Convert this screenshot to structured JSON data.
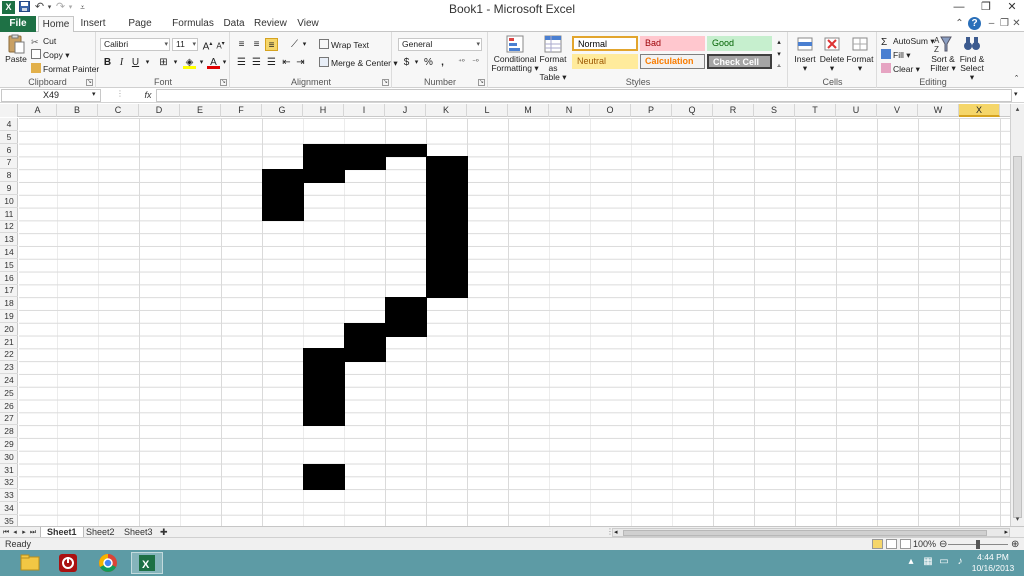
{
  "window": {
    "title": "Book1 - Microsoft Excel",
    "app_icon": "X"
  },
  "ribbon_tabs": [
    "File",
    "Home",
    "Insert",
    "Page Layout",
    "Formulas",
    "Data",
    "Review",
    "View"
  ],
  "active_tab": "Home",
  "clipboard": {
    "paste": "Paste",
    "cut": "Cut",
    "copy": "Copy",
    "format_painter": "Format Painter",
    "group": "Clipboard"
  },
  "font": {
    "name": "Calibri",
    "size": "11",
    "bold": "B",
    "italic": "I",
    "underline": "U",
    "group": "Font"
  },
  "alignment": {
    "wrap_text": "Wrap Text",
    "merge_center": "Merge & Center",
    "group": "Alignment"
  },
  "number": {
    "format": "General",
    "currency": "$",
    "percent": "%",
    "comma": ",",
    "group": "Number"
  },
  "styles": {
    "conditional": "Conditional Formatting",
    "conditional_l1": "Conditional",
    "conditional_l2": "Formatting",
    "table_l1": "Format",
    "table_l2": "as Table",
    "cells": [
      {
        "label": "Normal",
        "bg": "#ffffff",
        "fg": "#000000",
        "border": "#e2a52d"
      },
      {
        "label": "Bad",
        "bg": "#ffc7ce",
        "fg": "#9c0006",
        "border": "#ffc7ce"
      },
      {
        "label": "Good",
        "bg": "#c6efce",
        "fg": "#006100",
        "border": "#c6efce"
      },
      {
        "label": "Neutral",
        "bg": "#ffeb9c",
        "fg": "#9c5700",
        "border": "#ffeb9c"
      },
      {
        "label": "Calculation",
        "bg": "#f2f2f2",
        "fg": "#fa7d00",
        "border": "#7f7f7f"
      },
      {
        "label": "Check Cell",
        "bg": "#a5a5a5",
        "fg": "#ffffff",
        "border": "#3f3f3f"
      }
    ],
    "group": "Styles"
  },
  "cells_group": {
    "insert": "Insert",
    "delete": "Delete",
    "format": "Format",
    "group": "Cells"
  },
  "editing": {
    "autosum": "AutoSum",
    "fill": "Fill",
    "clear": "Clear",
    "sort_l1": "Sort &",
    "sort_l2": "Filter",
    "find_l1": "Find &",
    "find_l2": "Select",
    "group": "Editing"
  },
  "formula_bar": {
    "name_box": "X49",
    "fx": "fx",
    "value": ""
  },
  "grid": {
    "columns": [
      "A",
      "B",
      "C",
      "D",
      "E",
      "F",
      "G",
      "H",
      "I",
      "J",
      "K",
      "L",
      "M",
      "N",
      "O",
      "P",
      "Q",
      "R",
      "S",
      "T",
      "U",
      "V",
      "W",
      "X"
    ],
    "selected_column": "X",
    "first_row": 4,
    "rows": [
      "4",
      "5",
      "6",
      "7",
      "8",
      "9",
      "10",
      "11",
      "12",
      "13",
      "14",
      "15",
      "16",
      "17",
      "18",
      "19",
      "20",
      "21",
      "22",
      "23",
      "24",
      "25",
      "26",
      "27",
      "28",
      "29",
      "30",
      "31",
      "32",
      "33",
      "34",
      "35"
    ],
    "filled_cells": [
      {
        "col": "H",
        "row": 6
      },
      {
        "col": "I",
        "row": 6
      },
      {
        "col": "J",
        "row": 6
      },
      {
        "col": "H",
        "row": 7
      },
      {
        "col": "I",
        "row": 7
      },
      {
        "col": "K",
        "row": 7
      },
      {
        "col": "G",
        "row": 8
      },
      {
        "col": "H",
        "row": 8
      },
      {
        "col": "K",
        "row": 8
      },
      {
        "col": "G",
        "row": 9
      },
      {
        "col": "K",
        "row": 9
      },
      {
        "col": "G",
        "row": 10
      },
      {
        "col": "K",
        "row": 10
      },
      {
        "col": "G",
        "row": 11
      },
      {
        "col": "K",
        "row": 11
      },
      {
        "col": "K",
        "row": 12
      },
      {
        "col": "K",
        "row": 13
      },
      {
        "col": "K",
        "row": 14
      },
      {
        "col": "K",
        "row": 15
      },
      {
        "col": "K",
        "row": 16
      },
      {
        "col": "K",
        "row": 17
      },
      {
        "col": "J",
        "row": 18
      },
      {
        "col": "J",
        "row": 19
      },
      {
        "col": "J",
        "row": 20
      },
      {
        "col": "I",
        "row": 20
      },
      {
        "col": "I",
        "row": 21
      },
      {
        "col": "I",
        "row": 22
      },
      {
        "col": "H",
        "row": 22
      },
      {
        "col": "H",
        "row": 23
      },
      {
        "col": "H",
        "row": 24
      },
      {
        "col": "H",
        "row": 25
      },
      {
        "col": "H",
        "row": 26
      },
      {
        "col": "H",
        "row": 27
      },
      {
        "col": "H",
        "row": 31
      },
      {
        "col": "H",
        "row": 32
      }
    ]
  },
  "sheets": [
    "Sheet1",
    "Sheet2",
    "Sheet3"
  ],
  "active_sheet": "Sheet1",
  "status": {
    "ready": "Ready",
    "zoom": "100%"
  },
  "taskbar": {
    "apps": [
      "file-explorer",
      "power-app",
      "chrome",
      "excel"
    ],
    "time": "4:44 PM",
    "date": "10/16/2013"
  },
  "colors": {
    "file_tab": "#1e7145",
    "selected_header": "#f5d66a",
    "taskbar": "#5d9ba5"
  }
}
